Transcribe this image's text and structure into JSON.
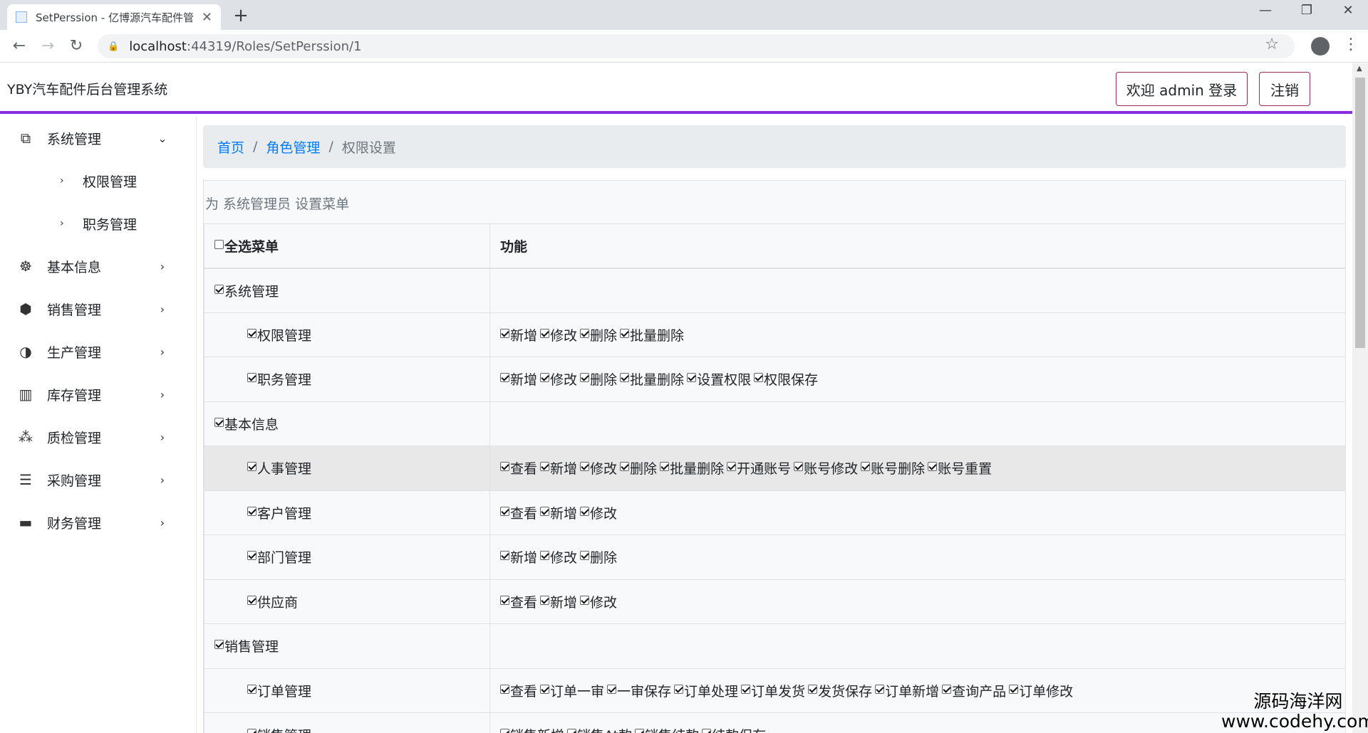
{
  "browser": {
    "tab_title": "SetPerssion - 亿博源汽车配件管",
    "tab_close": "✕",
    "new_tab": "+",
    "url_host": "localhost",
    "url_rest": ":44319/Roles/SetPerssion/1",
    "controls": {
      "minimize": "—",
      "maximize": "❐",
      "close": "✕"
    },
    "nav": {
      "back": "←",
      "forward": "→",
      "reload": "↻"
    },
    "lock": "🔒",
    "star": "☆",
    "menu": "⋮"
  },
  "header": {
    "brand": "YBY汽车配件后台管理系统",
    "welcome_button": "欢迎 admin 登录",
    "logout_button": "注销",
    "accent_color": "#8a2be2"
  },
  "sidebar": {
    "items": [
      {
        "label": "系统管理",
        "icon": "windows-icon",
        "glyph": "⧉",
        "expanded": true,
        "children": [
          {
            "label": "权限管理"
          },
          {
            "label": "职务管理"
          }
        ]
      },
      {
        "label": "基本信息",
        "icon": "accessibility-icon",
        "glyph": "☸"
      },
      {
        "label": "销售管理",
        "icon": "hexagon-icon",
        "glyph": "⬢"
      },
      {
        "label": "生产管理",
        "icon": "half-circle-icon",
        "glyph": "◑"
      },
      {
        "label": "库存管理",
        "icon": "map-icon",
        "glyph": "▥"
      },
      {
        "label": "质检管理",
        "icon": "cubes-icon",
        "glyph": "⁂"
      },
      {
        "label": "采购管理",
        "icon": "list-icon",
        "glyph": "☰"
      },
      {
        "label": "财务管理",
        "icon": "credit-card-icon",
        "glyph": "▬"
      }
    ],
    "chevron_down": "⌄",
    "chevron_right": "›"
  },
  "breadcrumb": {
    "home": "首页",
    "roles": "角色管理",
    "current": "权限设置",
    "separator": "/"
  },
  "permission": {
    "caption": "为 系统管理员 设置菜单",
    "col_menu": "全选菜单",
    "col_func": "功能",
    "rows": [
      {
        "level": 1,
        "label": "系统管理",
        "checked": true,
        "functions": []
      },
      {
        "level": 2,
        "label": "权限管理",
        "checked": true,
        "functions": [
          "新增",
          "修改",
          "删除",
          "批量删除"
        ]
      },
      {
        "level": 2,
        "label": "职务管理",
        "checked": true,
        "functions": [
          "新增",
          "修改",
          "删除",
          "批量删除",
          "设置权限",
          "权限保存"
        ]
      },
      {
        "level": 1,
        "label": "基本信息",
        "checked": true,
        "functions": []
      },
      {
        "level": 2,
        "label": "人事管理",
        "checked": true,
        "hover": true,
        "functions": [
          "查看",
          "新增",
          "修改",
          "删除",
          "批量删除",
          "开通账号",
          "账号修改",
          "账号删除",
          "账号重置"
        ]
      },
      {
        "level": 2,
        "label": "客户管理",
        "checked": true,
        "functions": [
          "查看",
          "新增",
          "修改"
        ]
      },
      {
        "level": 2,
        "label": "部门管理",
        "checked": true,
        "functions": [
          "新增",
          "修改",
          "删除"
        ]
      },
      {
        "level": 2,
        "label": "供应商",
        "checked": true,
        "functions": [
          "查看",
          "新增",
          "修改"
        ]
      },
      {
        "level": 1,
        "label": "销售管理",
        "checked": true,
        "functions": []
      },
      {
        "level": 2,
        "label": "订单管理",
        "checked": true,
        "functions": [
          "查看",
          "订单一审",
          "一审保存",
          "订单处理",
          "订单发货",
          "发货保存",
          "订单新增",
          "查询产品",
          "订单修改"
        ]
      },
      {
        "level": 2,
        "label": "销售管理",
        "checked": true,
        "functions": [
          "销售新增",
          "销售At款",
          "销售结款",
          "结款保存"
        ]
      }
    ]
  },
  "watermark": {
    "line1": "源码海洋网",
    "line2": "www.codehy.com"
  }
}
